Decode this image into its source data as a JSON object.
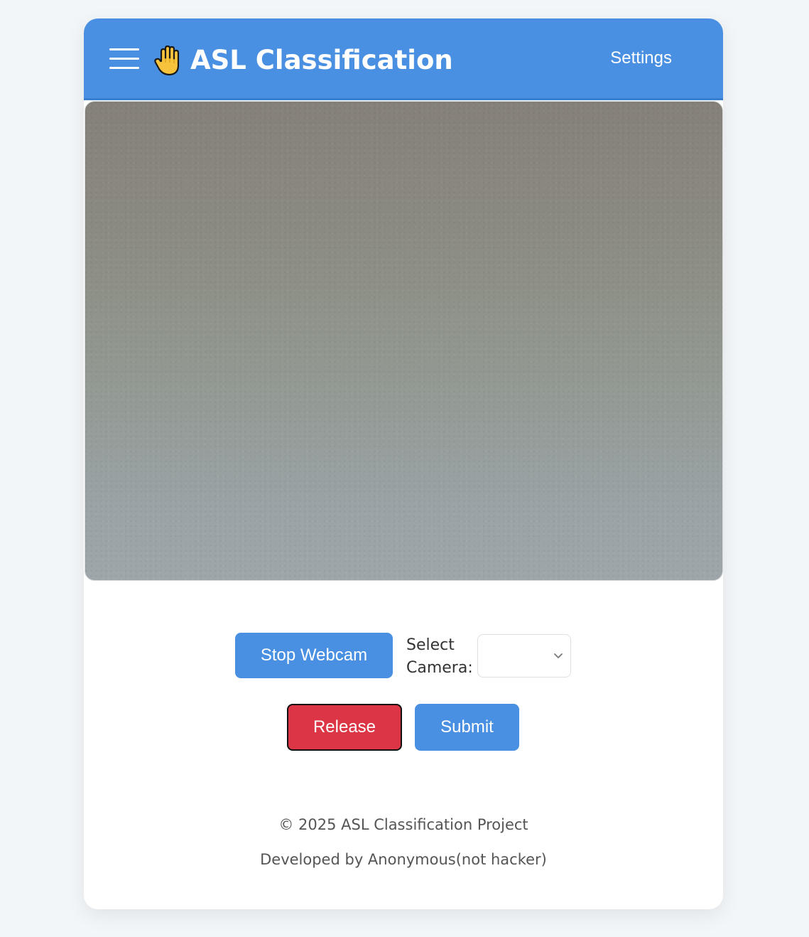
{
  "header": {
    "title": "ASL Classification",
    "settings_label": "Settings",
    "menu_icon": "hamburger-menu-icon",
    "logo_icon": "raised-hand-icon"
  },
  "webcam": {
    "feed": "webcam-video-feed"
  },
  "controls": {
    "stop_webcam_label": "Stop Webcam",
    "select_camera_label": "Select Camera:",
    "camera_selected_value": "",
    "release_label": "Release",
    "submit_label": "Submit"
  },
  "footer": {
    "copyright": "© 2025 ASL Classification Project",
    "developer": "Developed by Anonymous(not hacker)"
  },
  "colors": {
    "primary": "#4a90e2",
    "danger": "#dc3545",
    "background": "#f3f6f9"
  }
}
